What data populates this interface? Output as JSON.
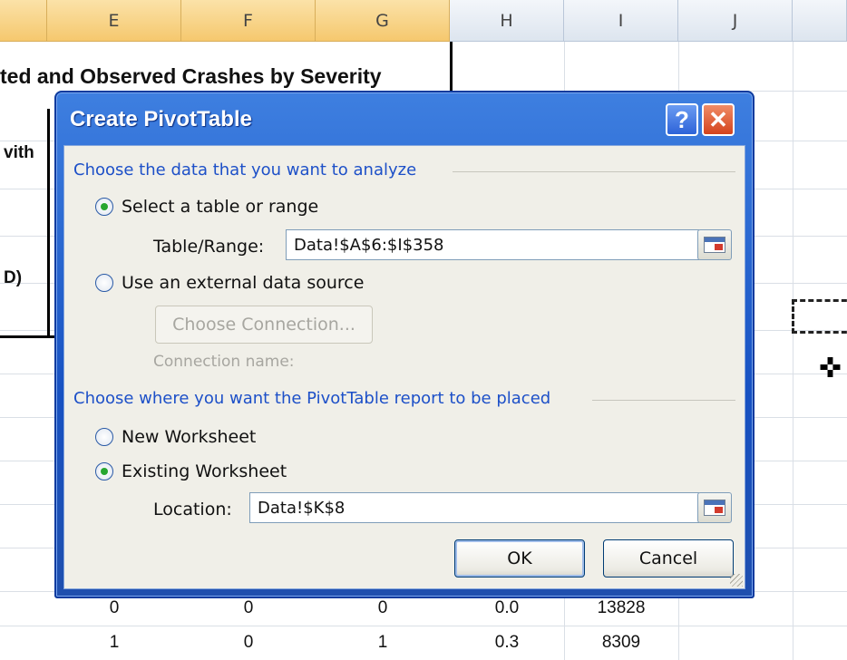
{
  "spreadsheet": {
    "columns": [
      "E",
      "F",
      "G",
      "H",
      "I",
      "J"
    ],
    "title_fragment": "ted and Observed Crashes by Severity",
    "left_fragments": [
      "vith",
      "D)"
    ],
    "bottom_rows": [
      [
        "0",
        "0",
        "0",
        "0.0",
        "13828"
      ],
      [
        "1",
        "0",
        "1",
        "0.3",
        "8309"
      ]
    ]
  },
  "dialog": {
    "title": "Create PivotTable",
    "help_glyph": "?",
    "close_glyph": "✕",
    "section1_label": "Choose the data that you want to analyze",
    "option_select_range": "Select a table or range",
    "table_range_label": "Table/Range:",
    "table_range_value": "Data!$A$6:$I$358",
    "option_external": "Use an external data source",
    "choose_connection_label": "Choose Connection...",
    "connection_name_label": "Connection name:",
    "section2_label": "Choose where you want the PivotTable report to be placed",
    "option_new_ws": "New Worksheet",
    "option_existing_ws": "Existing Worksheet",
    "location_label": "Location:",
    "location_value": "Data!$K$8",
    "ok_label": "OK",
    "cancel_label": "Cancel",
    "selected_source": "range",
    "selected_destination": "existing"
  },
  "icons": {
    "range_selector": "collapse-dialog-icon",
    "cursor": "cell-select-cursor-icon"
  }
}
